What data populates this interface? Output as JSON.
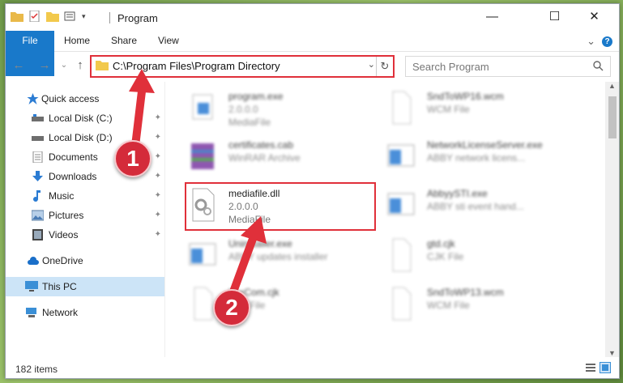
{
  "window": {
    "title": "Program",
    "controls": {
      "minimize": "—",
      "maximize": "☐",
      "close": "✕"
    }
  },
  "ribbon": {
    "tabs": [
      "File",
      "Home",
      "Share",
      "View"
    ],
    "expand_glyph": "⌄",
    "help_glyph": "?"
  },
  "nav": {
    "back": "←",
    "forward": "→",
    "recent": "⌄",
    "up": "↑",
    "address_path": "C:\\Program Files\\Program Directory",
    "address_dropdown": "⌄",
    "refresh": "↻",
    "search_placeholder": "Search Program"
  },
  "sidebar": {
    "items": [
      {
        "label": "Quick access",
        "icon": "star-icon"
      },
      {
        "label": "Local Disk (C:)",
        "icon": "drive-icon",
        "pinned": true
      },
      {
        "label": "Local Disk (D:)",
        "icon": "drive-icon",
        "pinned": true
      },
      {
        "label": "Documents",
        "icon": "documents-icon",
        "pinned": true
      },
      {
        "label": "Downloads",
        "icon": "download-icon",
        "pinned": true
      },
      {
        "label": "Music",
        "icon": "music-icon",
        "pinned": true
      },
      {
        "label": "Pictures",
        "icon": "pictures-icon",
        "pinned": true
      },
      {
        "label": "Videos",
        "icon": "videos-icon",
        "pinned": true
      },
      {
        "label": "OneDrive",
        "icon": "cloud-icon"
      },
      {
        "label": "This PC",
        "icon": "computer-icon",
        "selected": true
      },
      {
        "label": "Network",
        "icon": "network-icon"
      }
    ],
    "pin_glyph": "📌"
  },
  "files": [
    {
      "name": "program.exe",
      "line2": "2.0.0.0",
      "line3": "MediaFile",
      "icon": "exe-icon",
      "blurred": true
    },
    {
      "name": "SndToWP16.wcm",
      "line2": "WCM File",
      "line3": "",
      "icon": "blank-file-icon",
      "blurred": true
    },
    {
      "name": "certificates.cab",
      "line2": "WinRAR Archive",
      "line3": "",
      "icon": "archive-icon",
      "blurred": true
    },
    {
      "name": "NetworkLicenseServer.exe",
      "line2": "ABBY network licens...",
      "line3": "",
      "icon": "app-window-icon",
      "blurred": true
    },
    {
      "name": "mediafile.dll",
      "line2": "2.0.0.0",
      "line3": "MediaFile",
      "icon": "dll-gear-icon",
      "blurred": false
    },
    {
      "name": "AbbyySTI.exe",
      "line2": "ABBY sti event hand...",
      "line3": "",
      "icon": "app-window-icon",
      "blurred": true
    },
    {
      "name": "Uninstaller.exe",
      "line2": "ABBY updates installer",
      "line3": "",
      "icon": "app-window-icon",
      "blurred": true
    },
    {
      "name": "gtd.cjk",
      "line2": "CJK File",
      "line3": "",
      "icon": "blank-file-icon",
      "blurred": true
    },
    {
      "name": "LexCom.cjk",
      "line2": "CJK File",
      "line3": "",
      "icon": "blank-file-icon",
      "blurred": true
    },
    {
      "name": "SndToWP13.wcm",
      "line2": "WCM File",
      "line3": "",
      "icon": "blank-file-icon",
      "blurred": true
    }
  ],
  "status": {
    "item_count": "182 items"
  },
  "annotations": {
    "callout_1": "1",
    "callout_2": "2"
  },
  "colors": {
    "accent": "#1979ca",
    "highlight": "#e0303a",
    "callout": "#d42b3a",
    "selected": "#cce4f7"
  }
}
